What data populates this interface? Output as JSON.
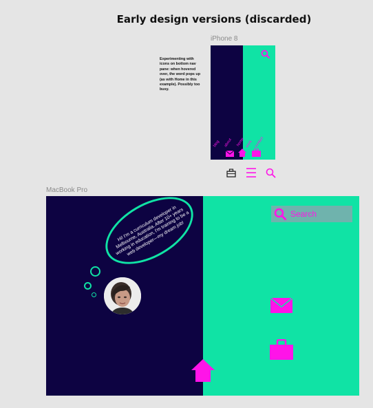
{
  "page": {
    "title": "Early design versions (discarded)"
  },
  "iphone": {
    "frame_label": "iPhone 8",
    "note": "Experimenting with icons on bottom nav pane: when hovered over, the word pops up (as with Home in this example). Possibly too busy.",
    "nav_words": [
      "blog",
      "about",
      "home",
      "work",
      "contact"
    ],
    "below_icons": [
      "briefcase-icon",
      "menu-icon",
      "search-icon"
    ]
  },
  "macbook": {
    "frame_label": "MacBook Pro",
    "search_placeholder": "Search",
    "bubble_text": "Hi! I'm a curriculum developer in Melbourne, Australia. After 10+ years working in education, I'm training to be a web developer—my dream job!"
  },
  "colors": {
    "navy": "#0d0342",
    "mint": "#10e3a5",
    "magenta": "#ff14e8",
    "background": "#e5e5e5"
  }
}
